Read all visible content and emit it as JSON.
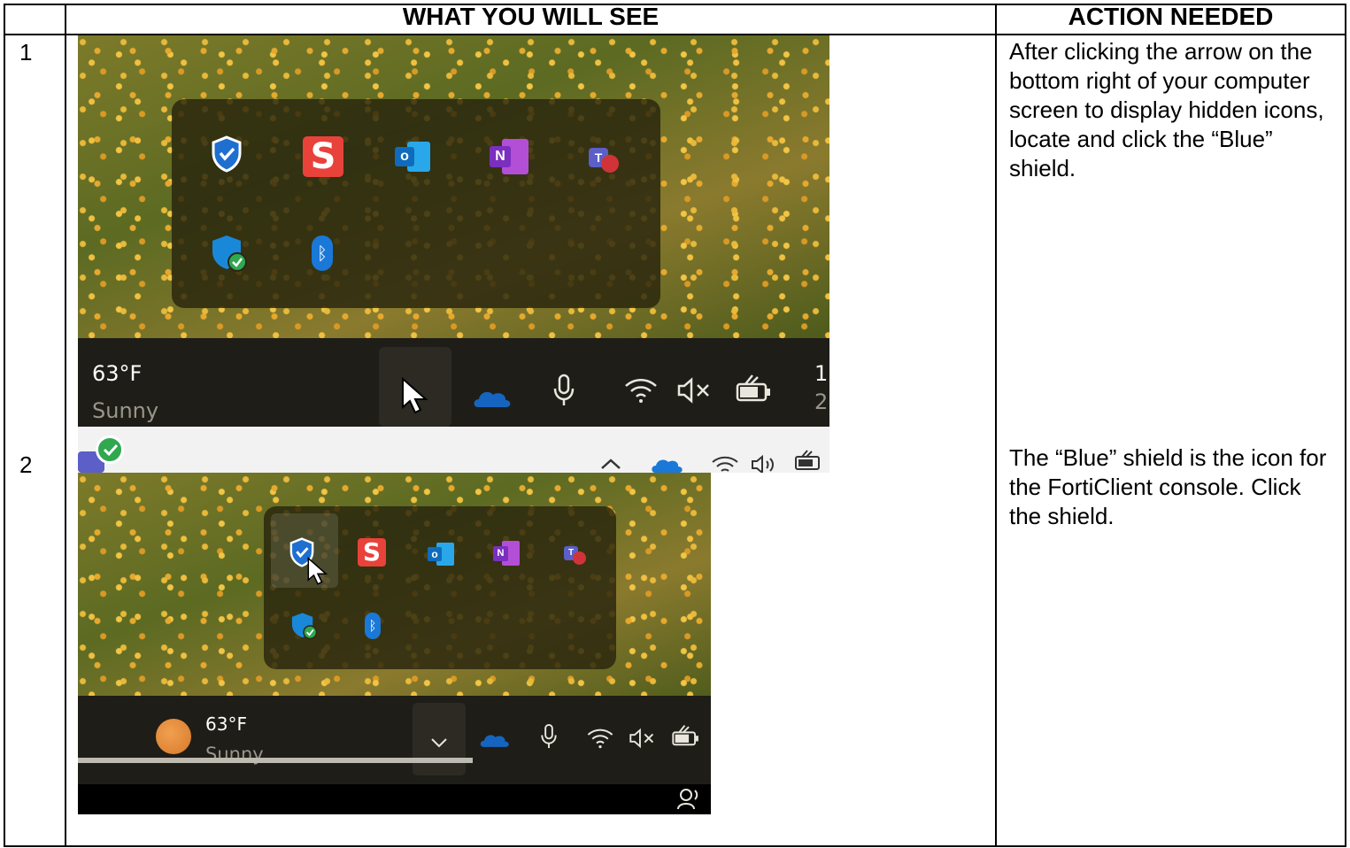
{
  "headers": {
    "col_see": "WHAT YOU WILL SEE",
    "col_action": "ACTION NEEDED"
  },
  "rows": [
    {
      "num": "1",
      "action": "After clicking the arrow on the bottom right of your computer screen to display hidden icons, locate and click the “Blue” shield."
    },
    {
      "num": "2",
      "action": "The “Blue” shield is the icon for the FortiClient console. Click the shield."
    }
  ],
  "screenshot1": {
    "temp": "63°F",
    "weather": "Sunny",
    "clock_partial_top": "1",
    "clock_partial_bottom": "2"
  },
  "screenshot2": {
    "temp": "63°F",
    "weather": "Sunny"
  },
  "tray_icons": [
    "forticlient-shield-icon",
    "snagit-icon",
    "outlook-icon",
    "onenote-icon",
    "teams-icon",
    "defender-shield-icon",
    "bluetooth-icon"
  ],
  "taskbar_icons": [
    "chevron-icon",
    "onedrive-icon",
    "microphone-icon",
    "wifi-icon",
    "volume-icon",
    "battery-icon"
  ],
  "colors": {
    "shield_blue": "#1e6fd0",
    "snagit_red": "#e8423a",
    "outlook_blue": "#0f6cbd",
    "onenote_purple": "#7b2fbe",
    "teams_purple": "#5b5fc7",
    "check_green": "#2fa84f"
  }
}
